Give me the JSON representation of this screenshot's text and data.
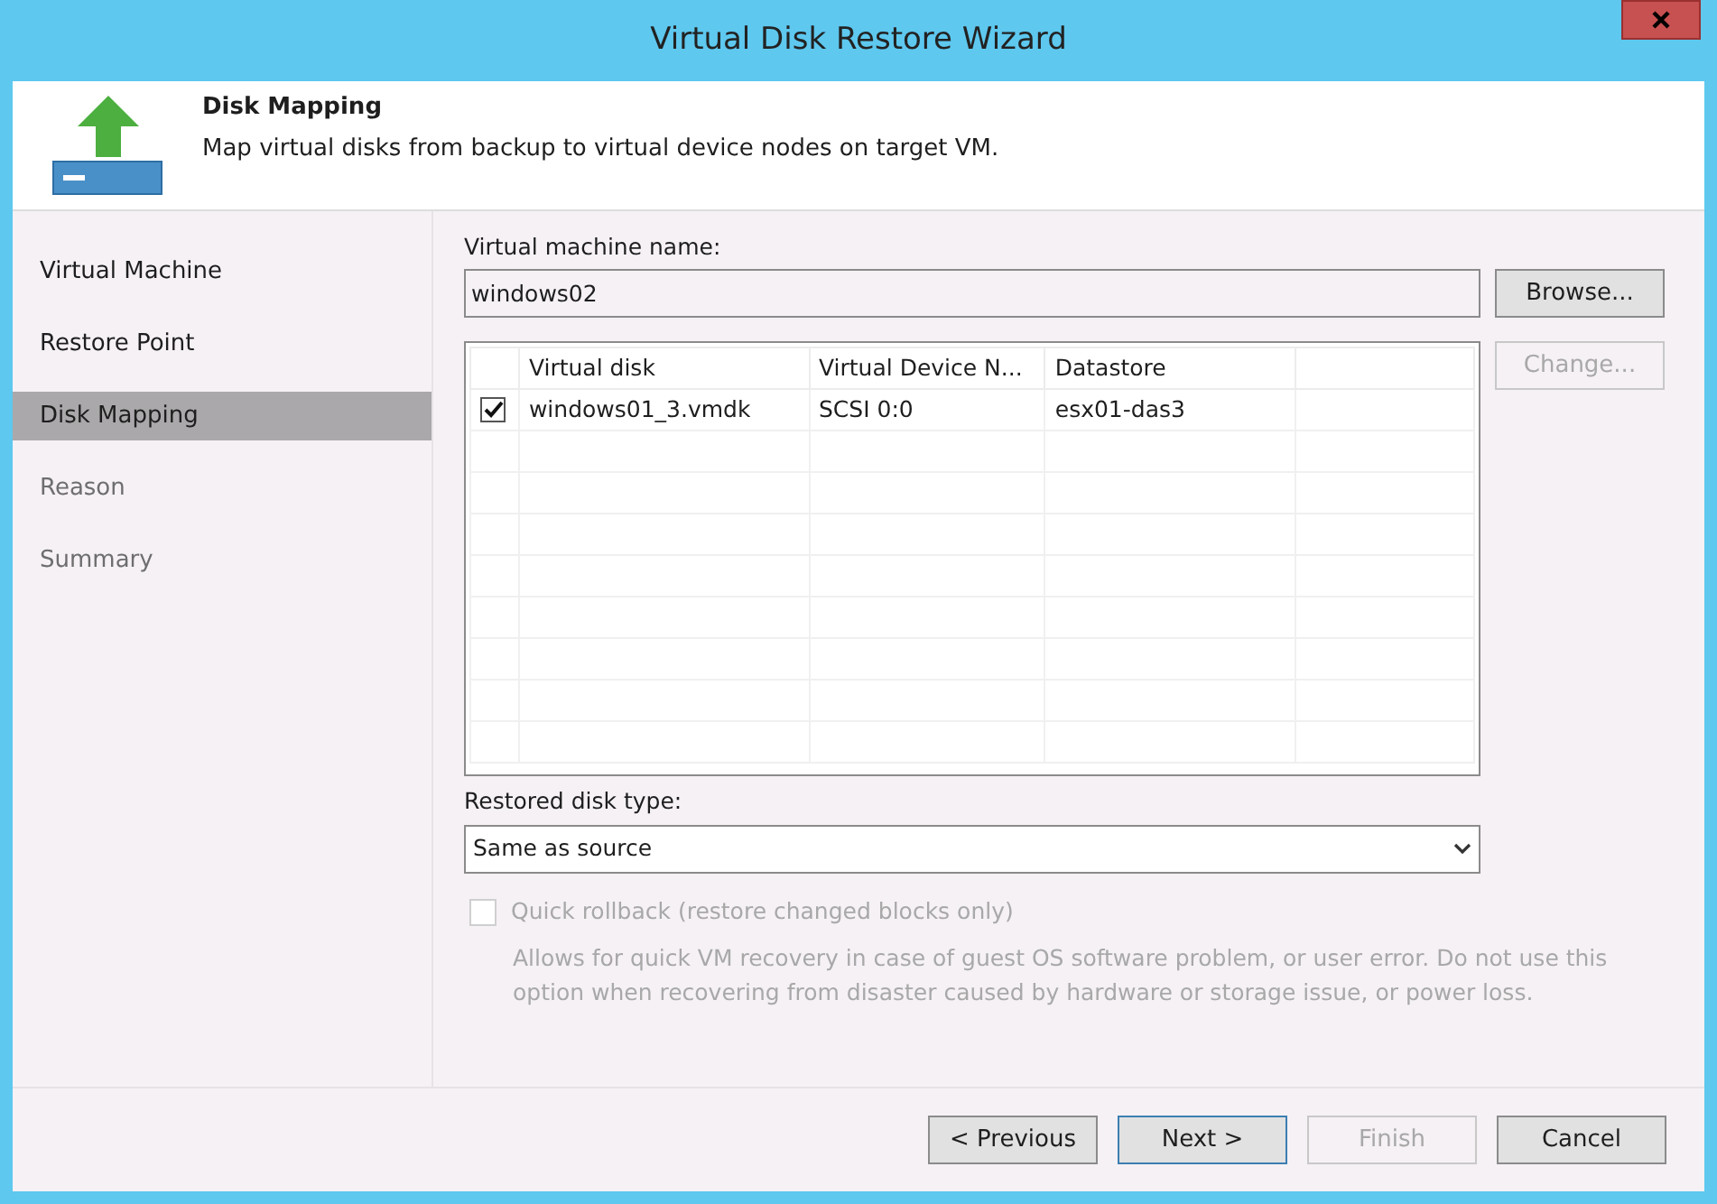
{
  "window": {
    "title": "Virtual Disk Restore Wizard"
  },
  "header": {
    "title": "Disk Mapping",
    "description": "Map virtual disks from backup to virtual device nodes on target VM."
  },
  "steps": [
    {
      "label": "Virtual Machine",
      "selected": false,
      "disabled": false
    },
    {
      "label": "Restore Point",
      "selected": false,
      "disabled": false
    },
    {
      "label": "Disk Mapping",
      "selected": true,
      "disabled": false
    },
    {
      "label": "Reason",
      "selected": false,
      "disabled": true
    },
    {
      "label": "Summary",
      "selected": false,
      "disabled": true
    }
  ],
  "vm_name": {
    "label": "Virtual machine name:",
    "value": "windows02"
  },
  "browse_button": {
    "label": "Browse...",
    "disabled": false
  },
  "change_button": {
    "label": "Change...",
    "disabled": true
  },
  "table": {
    "columns": [
      "Virtual disk",
      "Virtual Device N...",
      "Datastore"
    ],
    "rows": [
      {
        "checked": true,
        "cells": [
          "windows01_3.vmdk",
          "SCSI 0:0",
          "esx01-das3"
        ]
      }
    ]
  },
  "disk_type": {
    "label": "Restored disk type:",
    "value": "Same as source"
  },
  "quick_rollback": {
    "label": "Quick rollback (restore changed blocks only)",
    "checked": false,
    "disabled": true,
    "description": "Allows for quick VM recovery in case of guest OS software problem, or user error. Do not use this option when recovering from disaster caused by hardware or storage issue, or power loss."
  },
  "buttons": [
    {
      "label": "< Previous",
      "disabled": false,
      "default": false
    },
    {
      "label": "Next >",
      "disabled": false,
      "default": true
    },
    {
      "label": "Finish",
      "disabled": true,
      "default": false
    },
    {
      "label": "Cancel",
      "disabled": false,
      "default": false
    }
  ]
}
